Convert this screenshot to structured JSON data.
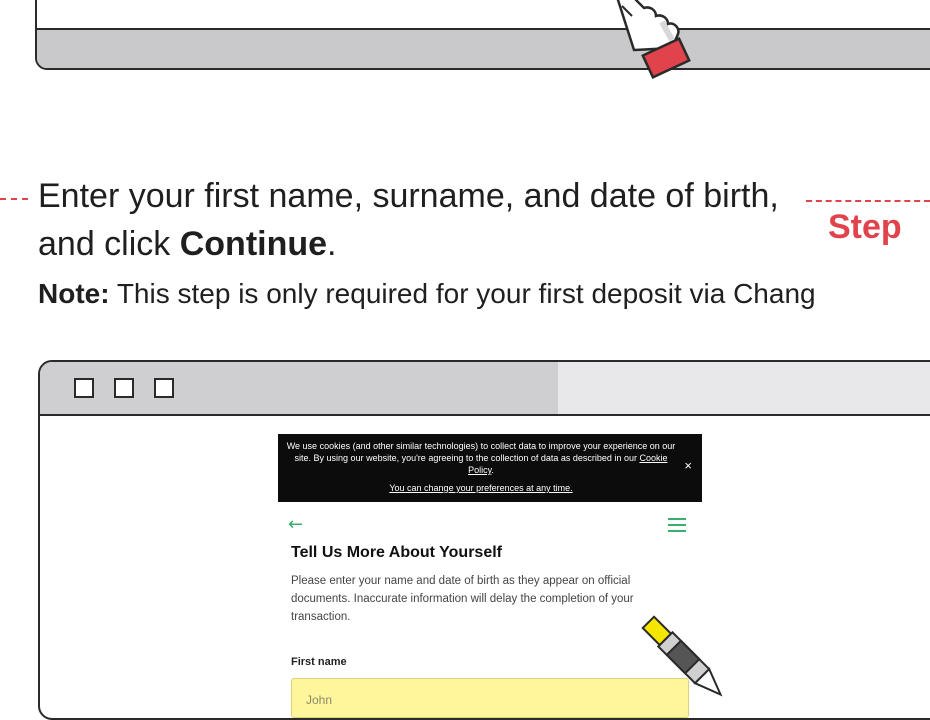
{
  "instruction": {
    "text_before": "Enter your first name, surname, and date of birth, and click ",
    "bold": "Continue",
    "text_after": "."
  },
  "note": {
    "label": "Note:",
    "text": " This step is only required for your first deposit via Chang"
  },
  "step_label": "Step",
  "cookie_banner": {
    "text_part1": "We use cookies (and other similar technologies) to collect data to improve your experience on our site. By using our website, you're agreeing to the collection of data as described in our ",
    "link": "Cookie Policy",
    "text_part2": ".",
    "preferences_link": "You can change your preferences at any time.",
    "close": "×"
  },
  "form": {
    "title": "Tell Us More About Yourself",
    "description": "Please enter your name and date of birth as they appear on official documents. Inaccurate information will delay the completion of your transaction.",
    "first_name_label": "First name",
    "first_name_value": "John"
  },
  "colors": {
    "accent": "#e0434b",
    "green": "#3cae6c",
    "highlight": "#fff59a"
  },
  "icons": [
    "pointing-hand-icon",
    "back-arrow-icon",
    "menu-icon",
    "close-icon",
    "pen-icon"
  ]
}
